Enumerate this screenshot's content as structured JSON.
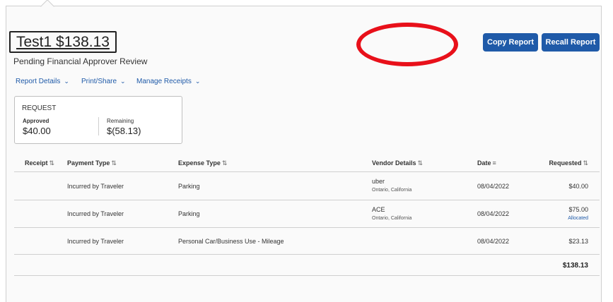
{
  "report": {
    "title": "Test1 $138.13",
    "status": "Pending Financial Approver Review"
  },
  "buttons": {
    "copy": "Copy Report",
    "recall": "Recall Report"
  },
  "menus": {
    "details": "Report Details",
    "print": "Print/Share",
    "receipts": "Manage Receipts"
  },
  "summary": {
    "title": "REQUEST",
    "approved_label": "Approved",
    "approved_value": "$40.00",
    "remaining_label": "Remaining",
    "remaining_value": "$(58.13)"
  },
  "table": {
    "headers": {
      "receipt": "Receipt",
      "payment": "Payment Type",
      "expense": "Expense Type",
      "vendor": "Vendor Details",
      "date": "Date",
      "requested": "Requested"
    },
    "rows": [
      {
        "payment": "Incurred by Traveler",
        "expense": "Parking",
        "vendor": "uber",
        "location": "Ontario, California",
        "date": "08/04/2022",
        "amount": "$40.00",
        "note": ""
      },
      {
        "payment": "Incurred by Traveler",
        "expense": "Parking",
        "vendor": "ACE",
        "location": "Ontario, California",
        "date": "08/04/2022",
        "amount": "$75.00",
        "note": "Allocated"
      },
      {
        "payment": "Incurred by Traveler",
        "expense": "Personal Car/Business Use - Mileage",
        "vendor": "",
        "location": "",
        "date": "08/04/2022",
        "amount": "$23.13",
        "note": ""
      }
    ],
    "total": "$138.13"
  },
  "colors": {
    "accent": "#1f5aa8",
    "annotation": "#e8101a"
  }
}
